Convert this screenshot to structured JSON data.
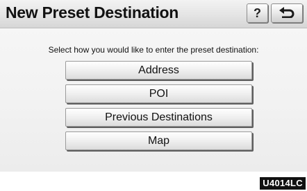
{
  "header": {
    "title": "New Preset Destination",
    "help_label": "?",
    "back_icon": "back-arrow-icon"
  },
  "main": {
    "instruction": "Select how you would like to enter the preset destination:",
    "options": [
      {
        "label": "Address"
      },
      {
        "label": "POI"
      },
      {
        "label": "Previous Destinations"
      },
      {
        "label": "Map"
      }
    ]
  },
  "figure_code": "U4014LC",
  "colors": {
    "background": "#f2f2f2",
    "header": "#dcdcdc",
    "button_shadow": "#5e5e5e",
    "code_label_bg": "#111111"
  }
}
